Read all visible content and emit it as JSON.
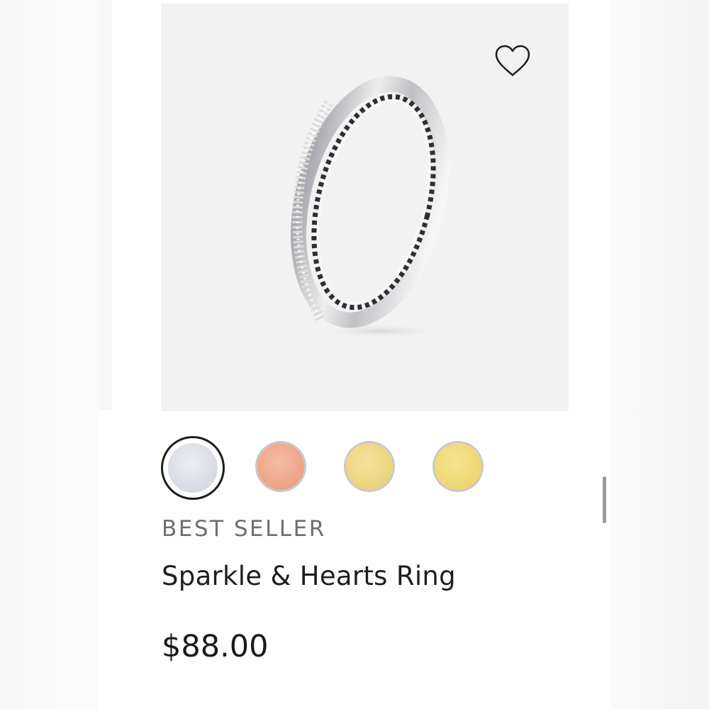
{
  "product": {
    "badge": "BEST SELLER",
    "name": "Sparkle & Hearts Ring",
    "price": "$88.00",
    "image_icon": "ring-product-image",
    "wishlist_icon": "heart-outline-icon"
  },
  "swatches": [
    {
      "metal": "silver",
      "color": "#dde1e8",
      "selected": true
    },
    {
      "metal": "rose-gold",
      "color": "#f0a889",
      "selected": false
    },
    {
      "metal": "gold",
      "color": "#ecd681",
      "selected": false
    },
    {
      "metal": "gold-alt",
      "color": "#efd977",
      "selected": false
    }
  ],
  "colors": {
    "image_background": "#f2f2f2",
    "text_primary": "#1e1e1e",
    "text_badge": "#6f6f6f",
    "selected_outline": "#1c1c1c"
  }
}
